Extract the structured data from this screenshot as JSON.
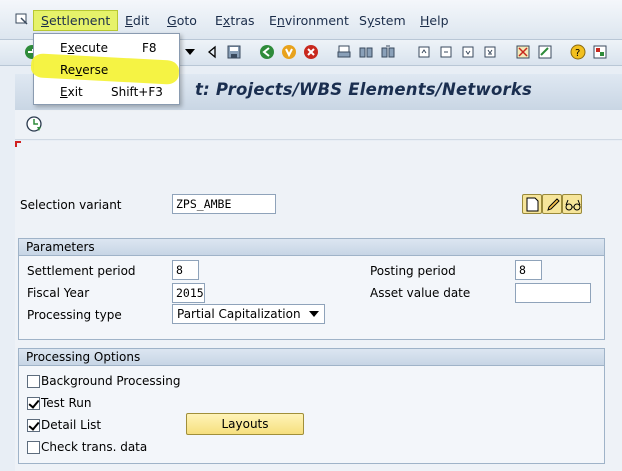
{
  "menubar": {
    "items": [
      {
        "label": "Settlement",
        "accel": "S",
        "rest": "ettlement"
      },
      {
        "label": "Edit",
        "accel": "E",
        "rest": "dit"
      },
      {
        "label": "Goto",
        "accel": "G",
        "rest": "oto"
      },
      {
        "label": "Extras",
        "accel": "x",
        "pre": "E",
        "rest": "tras"
      },
      {
        "label": "Environment",
        "accel": "n",
        "pre": "E",
        "rest": "vironment"
      },
      {
        "label": "System",
        "accel": "y",
        "pre": "S",
        "rest": "stem"
      },
      {
        "label": "Help",
        "accel": "H",
        "rest": "elp"
      }
    ]
  },
  "dropdown": {
    "items": [
      {
        "label": "Execute",
        "accel": "x",
        "pre": "E",
        "rest": "ecute",
        "shortcut": "F8"
      },
      {
        "label": "Reverse",
        "accel": "v",
        "pre": "Re",
        "rest": "erse",
        "shortcut": ""
      },
      {
        "label": "Exit",
        "accel": "E",
        "pre": "",
        "rest": "xit",
        "shortcut": "Shift+F3"
      }
    ]
  },
  "title": {
    "text": "t: Projects/WBS Elements/Networks"
  },
  "selection": {
    "label": "Selection variant",
    "value": "ZPS_AMBE"
  },
  "parameters": {
    "header": "Parameters",
    "settlement_period_label": "Settlement period",
    "settlement_period_value": "8",
    "fiscal_year_label": "Fiscal Year",
    "fiscal_year_value": "2015",
    "processing_type_label": "Processing type",
    "processing_type_value": "Partial Capitalization",
    "posting_period_label": "Posting period",
    "posting_period_value": "8",
    "asset_value_date_label": "Asset value date",
    "asset_value_date_value": ""
  },
  "options": {
    "header": "Processing Options",
    "background_label": "Background Processing",
    "background_checked": false,
    "test_run_label": "Test Run",
    "test_run_checked": true,
    "detail_list_label": "Detail List",
    "detail_list_checked": true,
    "check_trans_label": "Check trans. data",
    "check_trans_checked": false,
    "layouts_label": "Layouts"
  },
  "colors": {
    "menu_highlight": "#e6f26a",
    "marker": "#f4f23a",
    "title": "#1a2e4f"
  }
}
